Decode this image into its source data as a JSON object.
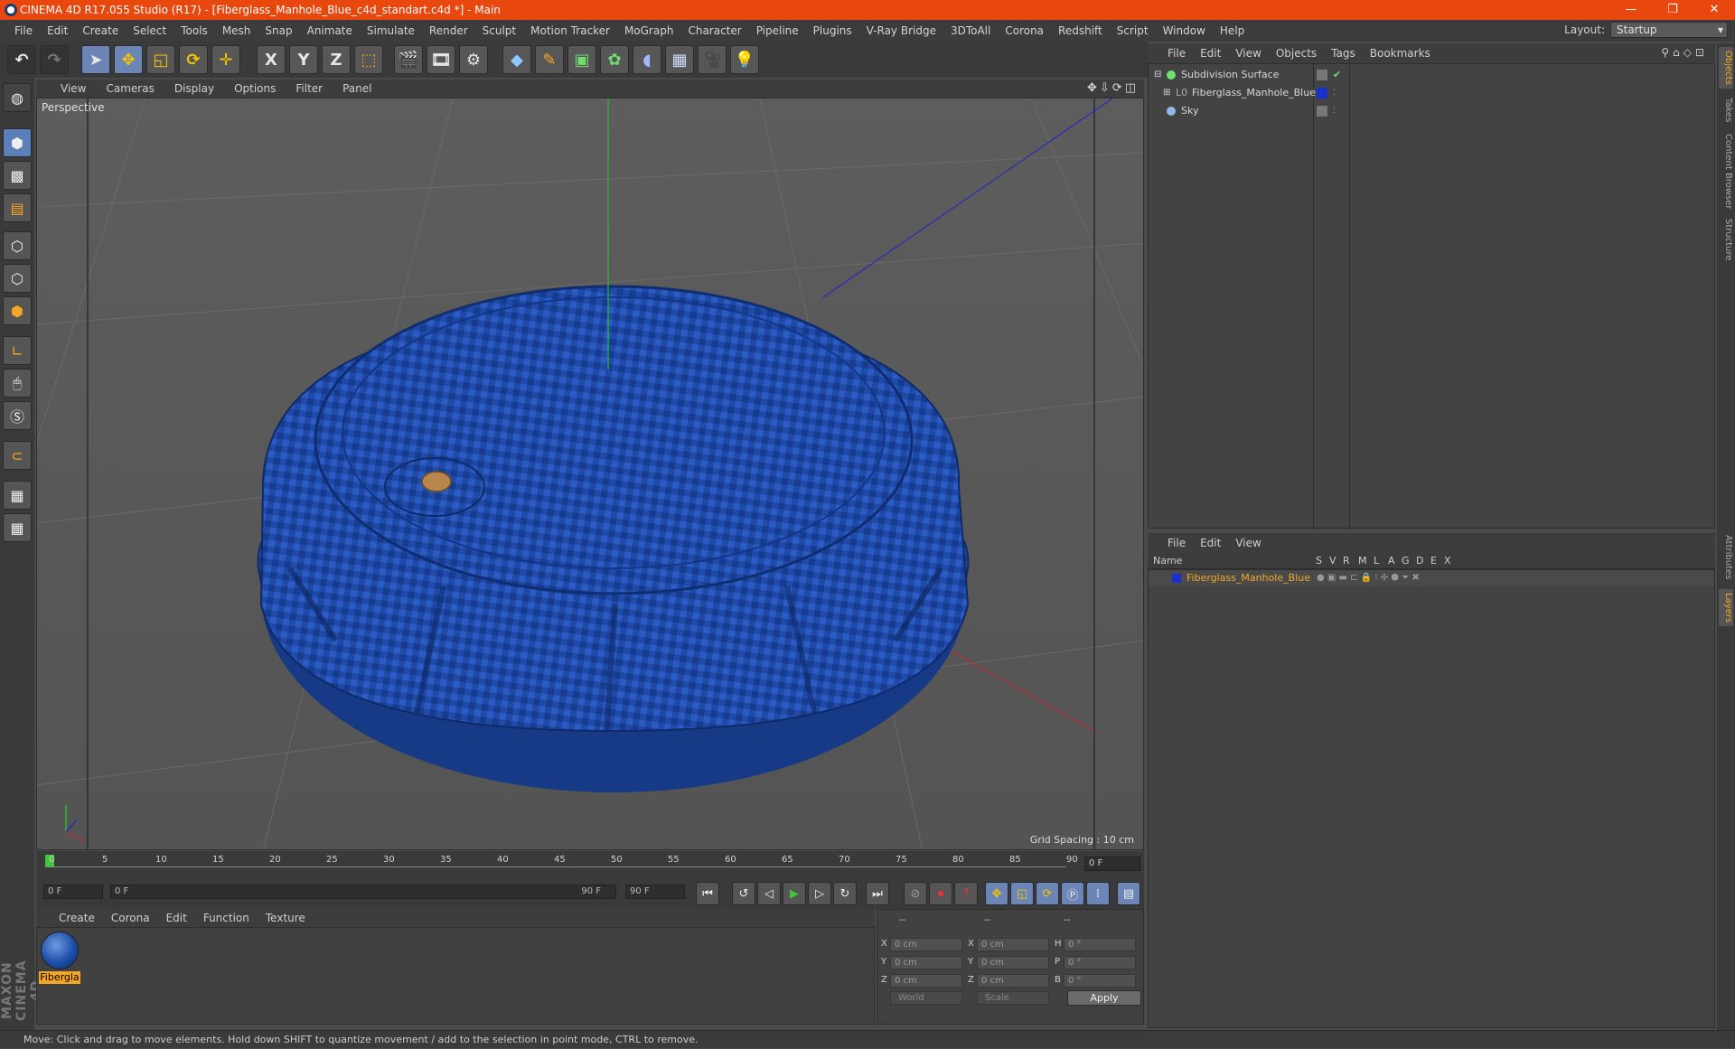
{
  "window": {
    "title": "CINEMA 4D R17.055 Studio (R17) - [Fiberglass_Manhole_Blue_c4d_standart.c4d *] - Main",
    "minimize": "—",
    "maximize": "❐",
    "close": "✕"
  },
  "menu": [
    "File",
    "Edit",
    "Create",
    "Select",
    "Tools",
    "Mesh",
    "Snap",
    "Animate",
    "Simulate",
    "Render",
    "Sculpt",
    "Motion Tracker",
    "MoGraph",
    "Character",
    "Pipeline",
    "Plugins",
    "V-Ray Bridge",
    "3DToAll",
    "Corona",
    "Redshift",
    "Script",
    "Window",
    "Help"
  ],
  "layout": {
    "label": "Layout:",
    "value": "Startup"
  },
  "toolbar": {
    "x": "X",
    "y": "Y",
    "z": "Z"
  },
  "viewport": {
    "menu": [
      "View",
      "Cameras",
      "Display",
      "Options",
      "Filter",
      "Panel"
    ],
    "label": "Perspective",
    "grid_spacing": "Grid Spacing : 10 cm",
    "nav_icons": "✥⇩⟳◫"
  },
  "timeline": {
    "ticks": [
      "0",
      "5",
      "10",
      "15",
      "20",
      "25",
      "30",
      "35",
      "40",
      "45",
      "50",
      "55",
      "60",
      "65",
      "70",
      "75",
      "80",
      "85",
      "90"
    ],
    "current_frame": "0 F",
    "start": "0 F",
    "range_start": "0 F",
    "range_end": "90 F",
    "end": "90 F"
  },
  "materials": {
    "menu": [
      "Create",
      "Corona",
      "Edit",
      "Function",
      "Texture"
    ],
    "items": [
      {
        "label": "Fibergla"
      }
    ]
  },
  "coords": {
    "headers": [
      "--",
      "--",
      "--"
    ],
    "rows": [
      {
        "a": "X",
        "av": "0 cm",
        "b": "X",
        "bv": "0 cm",
        "c": "H",
        "cv": "0 °"
      },
      {
        "a": "Y",
        "av": "0 cm",
        "b": "Y",
        "bv": "0 cm",
        "c": "P",
        "cv": "0 °"
      },
      {
        "a": "Z",
        "av": "0 cm",
        "b": "Z",
        "bv": "0 cm",
        "c": "B",
        "cv": "0 °"
      }
    ],
    "world": "World",
    "scale": "Scale",
    "apply": "Apply"
  },
  "status": "Move: Click and drag to move elements. Hold down SHIFT to quantize movement / add to the selection in point mode, CTRL to remove.",
  "objects": {
    "menu": [
      "File",
      "Edit",
      "View",
      "Objects",
      "Tags",
      "Bookmarks"
    ],
    "items": [
      {
        "name": "Subdivision Surface"
      },
      {
        "name": "Fiberglass_Manhole_Blue"
      },
      {
        "name": "Sky"
      }
    ]
  },
  "layers": {
    "menu": [
      "File",
      "Edit",
      "View"
    ],
    "columns": [
      "Name",
      "S",
      "V",
      "R",
      "M",
      "L",
      "A",
      "G",
      "D",
      "E",
      "X"
    ],
    "items": [
      {
        "name": "Fiberglass_Manhole_Blue",
        "color": "#1a2fd0"
      }
    ]
  },
  "side_tabs": [
    "Objects",
    "Takes",
    "Content Browser",
    "Structure",
    "Attributes",
    "Layers"
  ],
  "colors": {
    "titlebar": "#e8470e",
    "accent": "#f5a623",
    "selection": "#6a85b6",
    "object_blue": "#1f4aa8"
  },
  "brand": "MAXON CINEMA 4D"
}
